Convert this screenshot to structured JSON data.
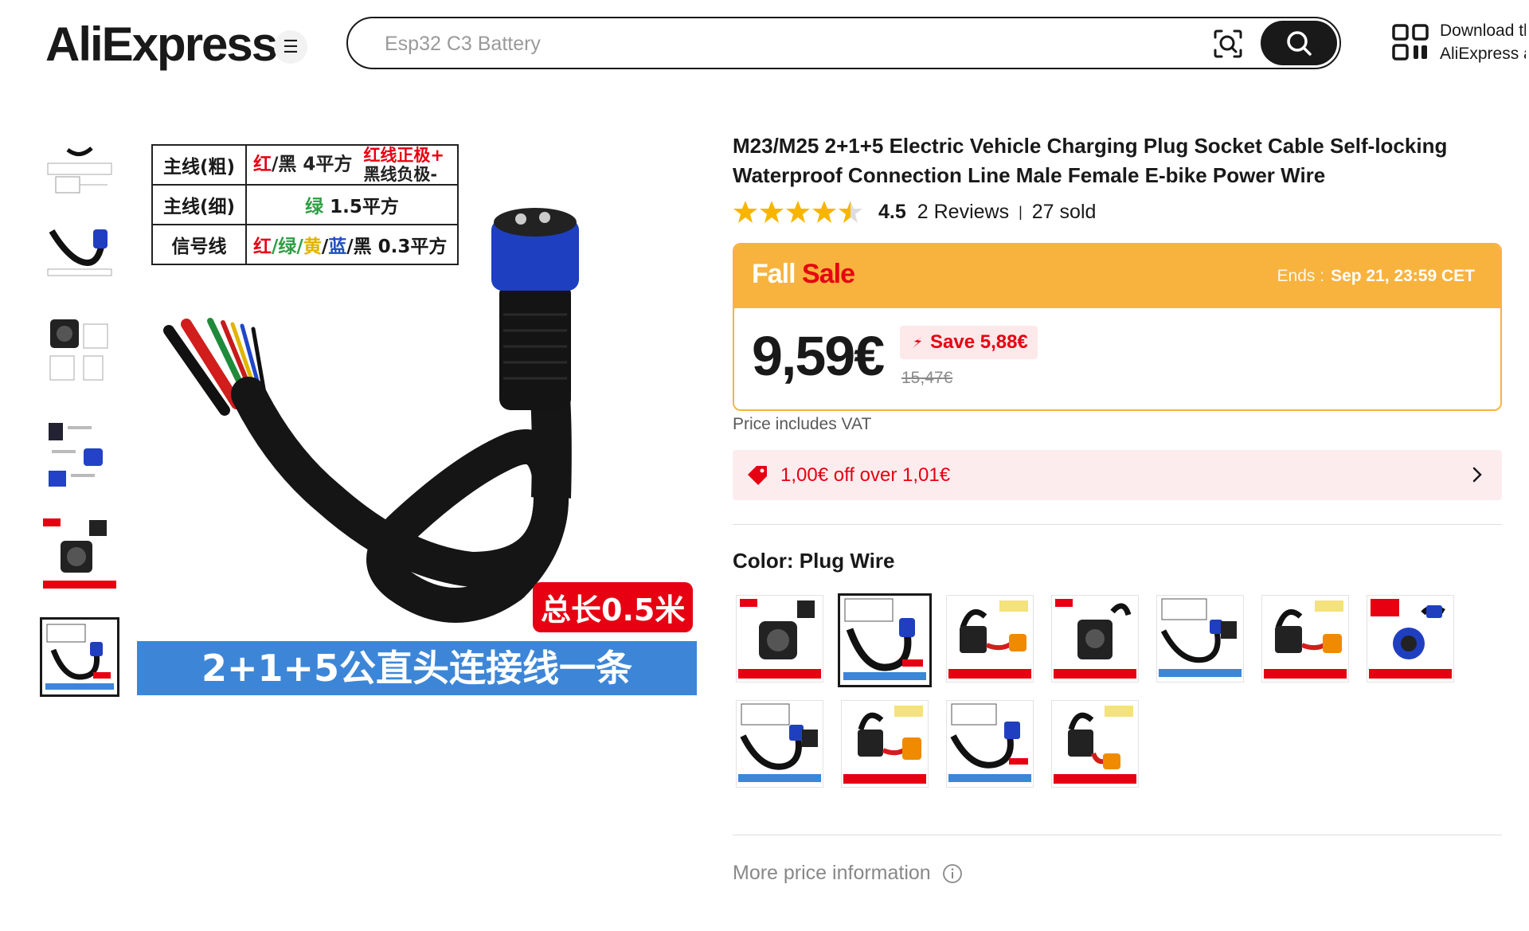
{
  "header": {
    "logo": "AliExpress",
    "search_placeholder": "Esp32 C3 Battery",
    "download_line1": "Download the",
    "download_line2": "AliExpress app"
  },
  "main_image": {
    "table": [
      {
        "head": "主线(粗)"
      },
      {
        "head": "主线(细)",
        "value": "1.5平方"
      },
      {
        "head": "信号线",
        "value": " 0.3平方"
      }
    ],
    "row1_value": "/黑 4平方",
    "row1_red": "红",
    "row1_note1": "红线正极+",
    "row1_note2": "黑线负极-",
    "row2_green": "绿",
    "row3_colors": [
      "红",
      "/绿/",
      "黄",
      "/",
      "蓝",
      "/黑"
    ],
    "length_tag": "总长0.5米",
    "banner": "2+1+5公直头连接线一条"
  },
  "product": {
    "title": "M23/M25 2+1+5 Electric Vehicle Charging Plug Socket Cable Self-locking Waterproof Connection Line Male Female E-bike Power Wire",
    "rating": "4.5",
    "rating_value": 4.5,
    "reviews": "2 Reviews",
    "sold": "27 sold"
  },
  "sale": {
    "label_1": "Fall",
    "label_2": "Sale",
    "ends_label": "Ends :",
    "ends_date": "Sep 21, 23:59 CET",
    "price": "9,59€",
    "save": "Save 5,88€",
    "original_price": "15,47€"
  },
  "vat": "Price includes VAT",
  "coupon": "1,00€ off over 1,01€",
  "color": {
    "label": "Color:",
    "value": "Plug Wire"
  },
  "more_price": "More price information",
  "colors": {
    "accent_orange": "#f7b33e",
    "sale_red": "#e60012",
    "coupon_bg": "#fdecee",
    "banner_blue": "#3d86d7"
  }
}
